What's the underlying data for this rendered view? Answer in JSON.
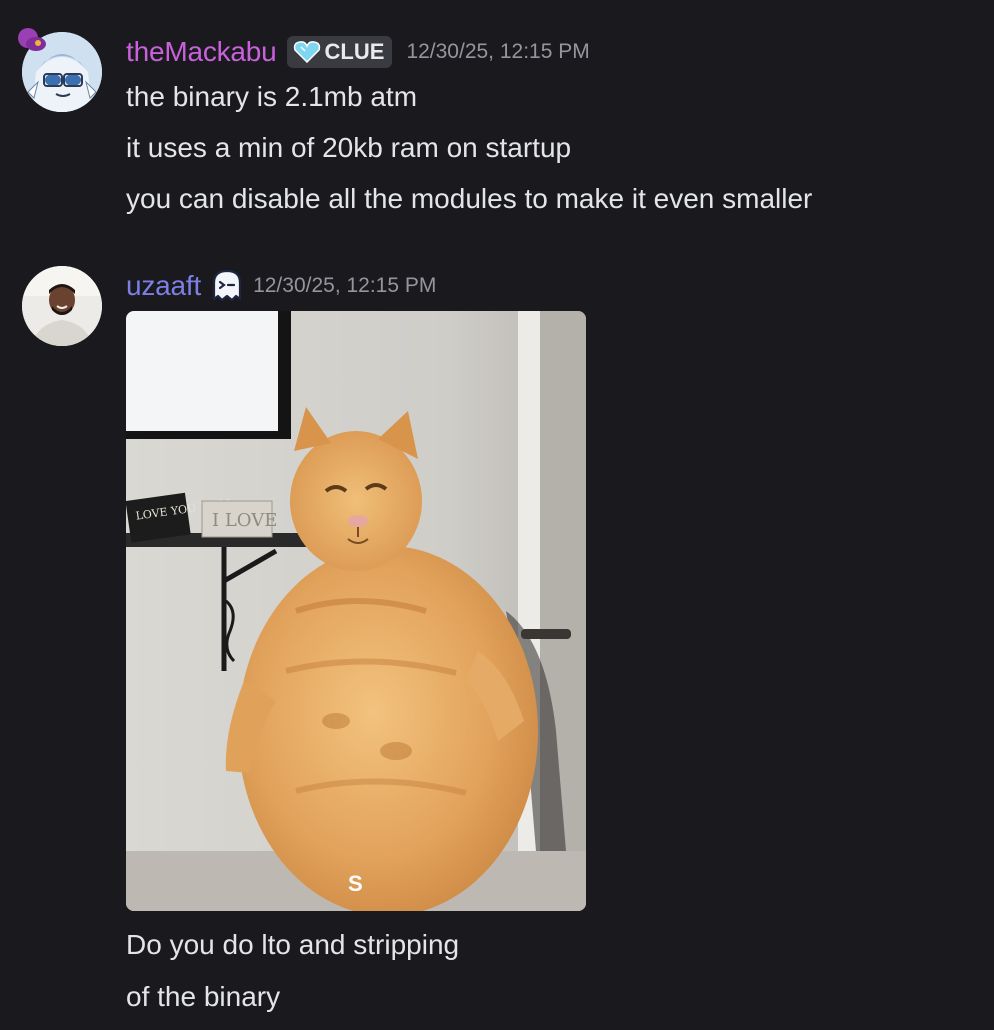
{
  "messages": [
    {
      "author": "theMackabu",
      "author_color": "#c961dc",
      "tag": "CLUE",
      "timestamp": "12/30/25, 12:15 PM",
      "lines": [
        "the binary is 2.1mb atm",
        "it uses a min of 20kb ram on startup",
        "you can disable all the modules to make it even smaller"
      ]
    },
    {
      "author": "uzaaft",
      "author_color": "#7c7fe3",
      "badge_icon": "ghost-icon",
      "timestamp": "12/30/25, 12:15 PM",
      "attachment": {
        "type": "gif",
        "icon": "orange-cat-gif",
        "sign_text_1": "LOVE YOU MOM",
        "sign_text_2": "I LOVE",
        "caption_letter": "S"
      },
      "lines": [
        "Do you do lto and stripping",
        "of the binary"
      ]
    }
  ]
}
